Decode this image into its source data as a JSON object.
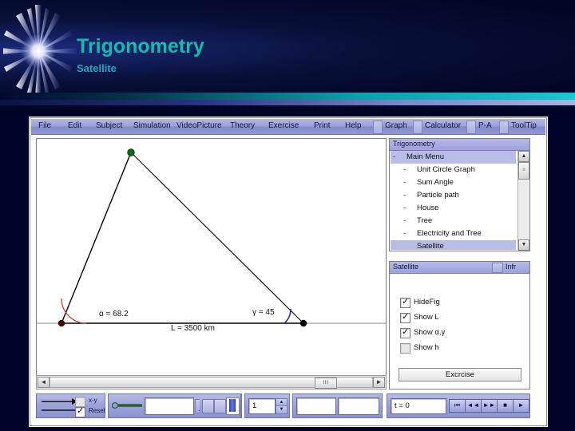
{
  "slide": {
    "title": "Trigonometry",
    "subtitle": "Satellite",
    "accent_color": "#19b8b8",
    "background_color": "#020626"
  },
  "app": {
    "menu": [
      "File",
      "Edit",
      "Subject",
      "Simulation",
      "VideoPicture",
      "Theory",
      "Exercise",
      "Print",
      "Help"
    ],
    "toolbar_buttons": [
      "Graph",
      "Calculator",
      "P-A",
      "ToolTip"
    ]
  },
  "graph": {
    "figure": {
      "type": "triangle",
      "alpha_label": "α = 68.2",
      "gamma_label": "γ = 45",
      "base_label": "L = 3500 km",
      "alpha_value": 68.2,
      "gamma_value": 45,
      "base_value": 3500,
      "base_unit": "km",
      "apex_color": "#0a6e10",
      "left_vertex_color": "#400000",
      "right_vertex_color": "#000000",
      "alpha_arc_color": "#c04040",
      "gamma_arc_color": "#2030c0"
    },
    "hscrollbar": {
      "left_arrow": "◄",
      "right_arrow": "►",
      "thumb_grip": "III"
    }
  },
  "tree_panel": {
    "title": "Trigonometry",
    "items": [
      {
        "label": "Main Menu",
        "level": 0,
        "selected": true
      },
      {
        "label": "Unit Circle Graph",
        "level": 1,
        "selected": false
      },
      {
        "label": "Sum Angle",
        "level": 1,
        "selected": false
      },
      {
        "label": "Particle path",
        "level": 1,
        "selected": false
      },
      {
        "label": "House",
        "level": 1,
        "selected": false
      },
      {
        "label": "Tree",
        "level": 1,
        "selected": false
      },
      {
        "label": "Electricity and Tree",
        "level": 1,
        "selected": false
      },
      {
        "label": "Satellite",
        "level": 1,
        "selected": true
      }
    ],
    "scrollbar": {
      "up_arrow": "▲",
      "down_arrow": "▼",
      "thumb_grip": "≡"
    }
  },
  "options_panel": {
    "title": "Satellite",
    "info_button": "Infr",
    "checkboxes": [
      {
        "label": "HideFig",
        "checked": true
      },
      {
        "label": "Show L",
        "checked": true
      },
      {
        "label": "Show α,γ",
        "checked": true
      },
      {
        "label": "Show h",
        "checked": false
      }
    ],
    "exercise_button": "Excrcise"
  },
  "bottom_toolbar": {
    "draw_checkbox_xy": {
      "label": "x-y",
      "checked": false
    },
    "draw_checkbox_reset": {
      "label": "Reset",
      "checked": true
    },
    "slider_value": "",
    "line_width_field": "",
    "dropdown_value": ".",
    "dropdown_arrow": "▼",
    "spinner_value": "1",
    "spinner_up": "▲",
    "spinner_down": "▼",
    "field_a": "",
    "field_b": "",
    "time_label": "t = 0",
    "media_buttons": [
      {
        "name": "rewind-to-start",
        "glyph": "⏮"
      },
      {
        "name": "step-back",
        "glyph": "◄◄"
      },
      {
        "name": "play-forward",
        "glyph": "►►"
      },
      {
        "name": "stop",
        "glyph": "■"
      },
      {
        "name": "play",
        "glyph": "►"
      }
    ]
  }
}
